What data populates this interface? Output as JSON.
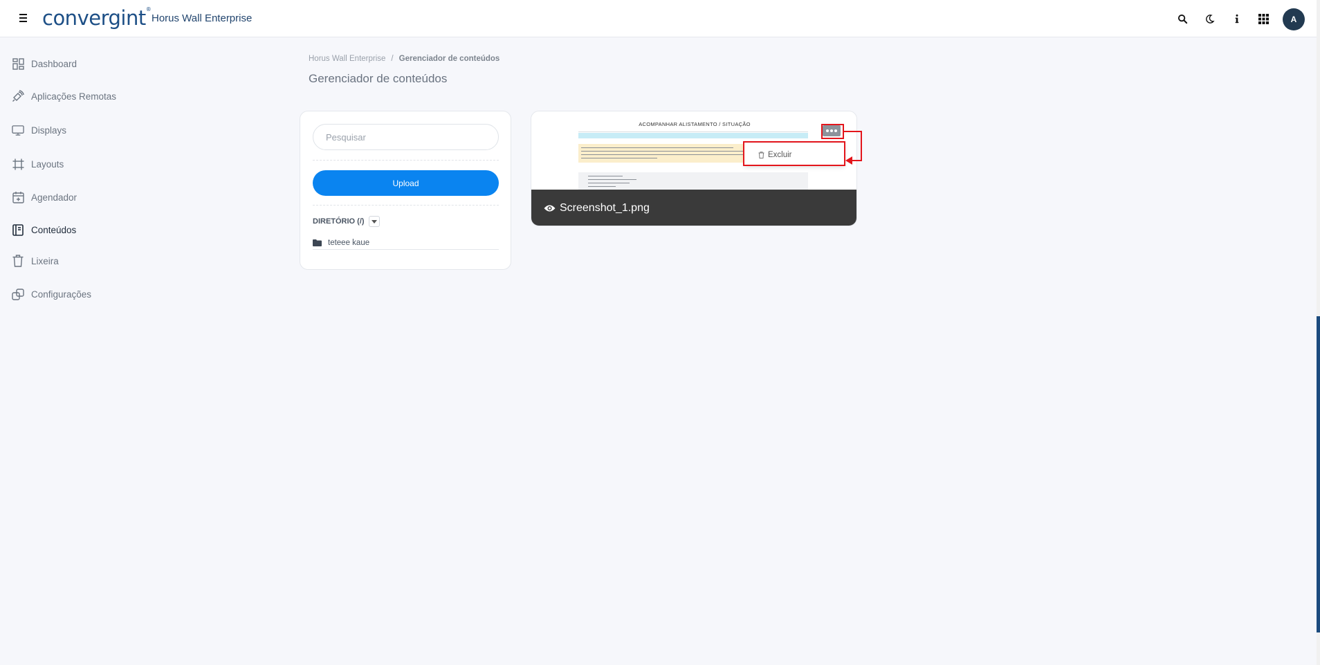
{
  "header": {
    "logo_text": "convergint",
    "app_title": "Horus Wall Enterprise",
    "avatar_initial": "A",
    "icons": [
      "search-icon",
      "moon-icon",
      "info-icon",
      "apps-grid-icon"
    ]
  },
  "sidebar": {
    "items": [
      {
        "label": "Dashboard",
        "icon": "dashboard-icon"
      },
      {
        "label": "Aplicações Remotas",
        "icon": "satellite-icon"
      },
      {
        "label": "Displays",
        "icon": "monitor-icon"
      },
      {
        "label": "Layouts",
        "icon": "layout-icon"
      },
      {
        "label": "Agendador",
        "icon": "calendar-icon"
      },
      {
        "label": "Conteúdos",
        "icon": "content-icon",
        "active": true
      },
      {
        "label": "Lixeira",
        "icon": "trash-icon"
      },
      {
        "label": "Configurações",
        "icon": "settings-icon"
      }
    ]
  },
  "breadcrumb": {
    "root": "Horus Wall Enterprise",
    "separator": "/",
    "current": "Gerenciador de conteúdos"
  },
  "page_title": "Gerenciador de conteúdos",
  "files_panel": {
    "search_placeholder": "Pesquisar",
    "upload_label": "Upload",
    "directory_label": "DIRETÓRIO (/)",
    "folders": [
      "teteee kaue"
    ]
  },
  "content_item": {
    "file_name": "Screenshot_1.png",
    "preview_title": "ACOMPANHAR ALISTAMENTO / SITUAÇÃO",
    "menu": {
      "delete_label": "Excluir"
    }
  },
  "colors": {
    "primary": "#0a84f0",
    "brand": "#1d4f86",
    "annotation": "#e3151b",
    "footer_overlay": "#3a3a3a"
  }
}
